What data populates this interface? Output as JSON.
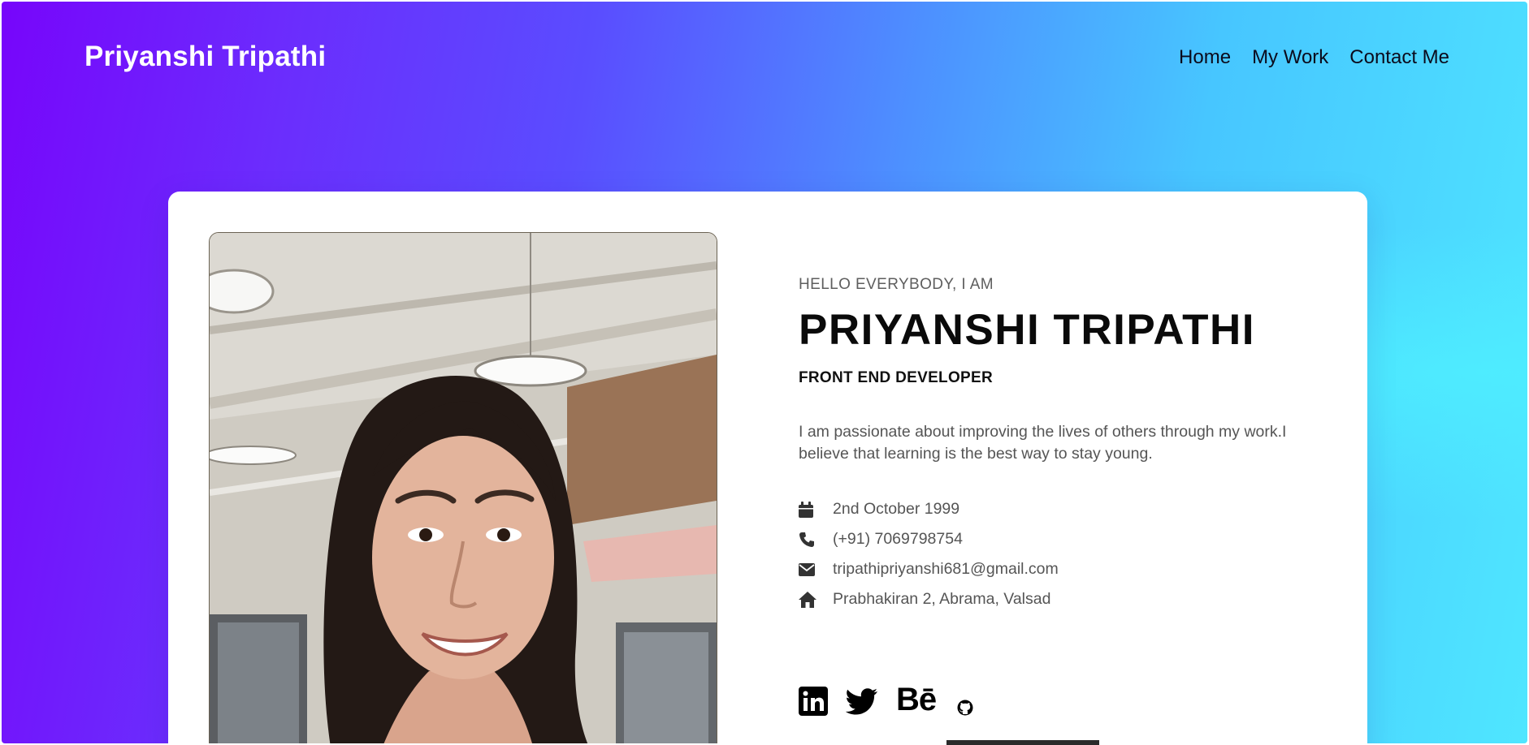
{
  "header": {
    "brand": "Priyanshi Tripathi",
    "nav": [
      {
        "label": "Home"
      },
      {
        "label": "My Work"
      },
      {
        "label": "Contact Me"
      }
    ]
  },
  "profile": {
    "greeting": "HELLO EVERYBODY, I AM",
    "name": "PRIYANSHI TRIPATHI",
    "role": "FRONT END DEVELOPER",
    "bio": "I am passionate about improving the lives of others through my work.I believe that learning is the best way to stay young.",
    "details": {
      "birthday": "2nd October 1999",
      "phone": "(+91) 7069798754",
      "email": "tripathipriyanshi681@gmail.com",
      "address": "Prabhakiran 2, Abrama, Valsad"
    }
  },
  "social": {
    "behance_label": "Bē",
    "icons": [
      "linkedin-icon",
      "twitter-icon",
      "behance-icon",
      "github-icon"
    ]
  },
  "colors": {
    "gradient_start": "#7705fb",
    "gradient_mid": "#5a4dff",
    "gradient_end": "#4fe6ff",
    "card_bg": "#ffffff",
    "text_dark": "#0a0a0a",
    "text_muted": "#555555"
  }
}
